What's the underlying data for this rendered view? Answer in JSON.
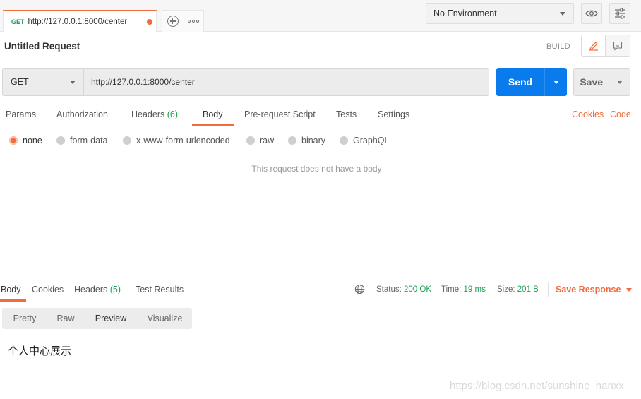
{
  "tab": {
    "method": "GET",
    "url": "http://127.0.0.1:8000/center"
  },
  "environment": {
    "selected": "No Environment"
  },
  "request": {
    "title": "Untitled Request",
    "build_label": "BUILD"
  },
  "url_bar": {
    "method": "GET",
    "url": "http://127.0.0.1:8000/center",
    "send_label": "Send",
    "save_label": "Save"
  },
  "request_tabs": [
    {
      "label": "Params"
    },
    {
      "label": "Authorization"
    },
    {
      "label": "Headers",
      "count": "(6)"
    },
    {
      "label": "Body",
      "active": true
    },
    {
      "label": "Pre-request Script"
    },
    {
      "label": "Tests"
    },
    {
      "label": "Settings"
    }
  ],
  "request_links": {
    "cookies": "Cookies",
    "code": "Code"
  },
  "body_types": [
    {
      "label": "none",
      "selected": true
    },
    {
      "label": "form-data"
    },
    {
      "label": "x-www-form-urlencoded"
    },
    {
      "label": "raw"
    },
    {
      "label": "binary"
    },
    {
      "label": "GraphQL"
    }
  ],
  "body_empty_message": "This request does not have a body",
  "response_tabs": [
    {
      "label": "Body",
      "active": true
    },
    {
      "label": "Cookies"
    },
    {
      "label": "Headers",
      "count": "(5)"
    },
    {
      "label": "Test Results"
    }
  ],
  "response_meta": {
    "status_label": "Status:",
    "status_value": "200 OK",
    "time_label": "Time:",
    "time_value": "19 ms",
    "size_label": "Size:",
    "size_value": "201 B",
    "save_response": "Save Response"
  },
  "view_modes": [
    {
      "label": "Pretty"
    },
    {
      "label": "Raw"
    },
    {
      "label": "Preview",
      "active": true
    },
    {
      "label": "Visualize"
    }
  ],
  "response_body": "个人中心展示",
  "watermark": "https://blog.csdn.net/sunshine_hanxx",
  "colors": {
    "accent": "#f26b3a",
    "primary": "#097bed",
    "success": "#1e9f55"
  }
}
